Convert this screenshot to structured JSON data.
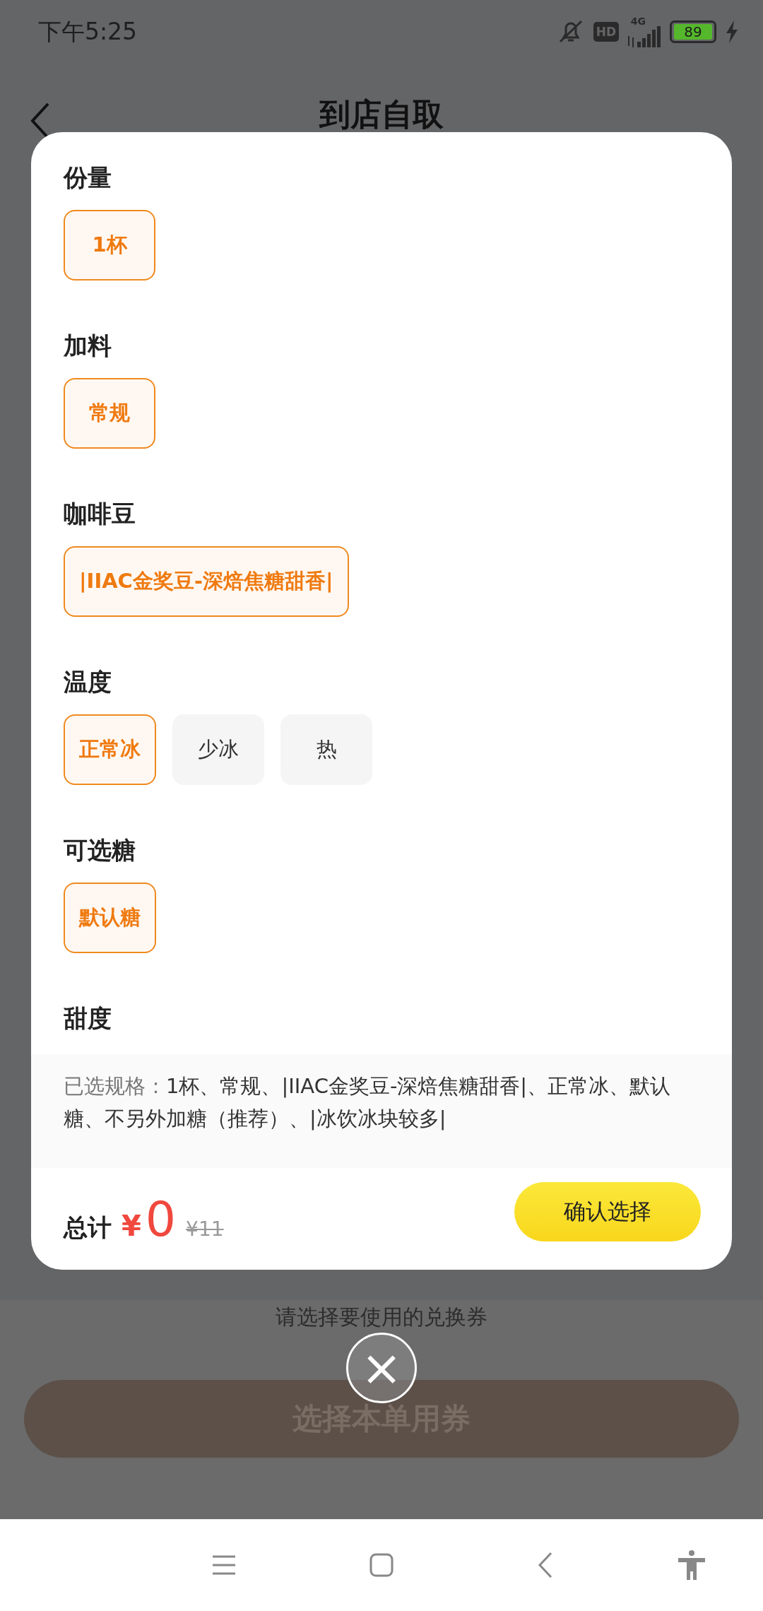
{
  "status_bar": {
    "time": "下午5:25",
    "hd": "HD",
    "network": "4G",
    "battery": "89"
  },
  "nav_bar": {
    "title": "到店自取"
  },
  "footer": {
    "hint": "请选择要使用的兑换券",
    "button": "选择本单用券"
  },
  "sheet": {
    "sections": [
      {
        "title": "份量",
        "options": [
          {
            "label": "1杯",
            "selected": true
          }
        ]
      },
      {
        "title": "加料",
        "options": [
          {
            "label": "常规",
            "selected": true
          }
        ]
      },
      {
        "title": "咖啡豆",
        "options": [
          {
            "label": "|IIAC金奖豆-深焙焦糖甜香|",
            "selected": true
          }
        ]
      },
      {
        "title": "温度",
        "options": [
          {
            "label": "正常冰",
            "selected": true
          },
          {
            "label": "少冰",
            "selected": false
          },
          {
            "label": "热",
            "selected": false
          }
        ]
      },
      {
        "title": "可选糖",
        "options": [
          {
            "label": "默认糖",
            "selected": true
          }
        ]
      },
      {
        "title": "甜度"
      }
    ],
    "summary_label": "已选规格：",
    "summary": "1杯、常规、|IIAC金奖豆-深焙焦糖甜香|、正常冰、默认糖、不另外加糖（推荐）、|冰饮冰块较多|",
    "total_label": "总计",
    "currency": "¥",
    "price": "0",
    "original_price": "¥11",
    "confirm": "确认选择"
  },
  "close": "×"
}
